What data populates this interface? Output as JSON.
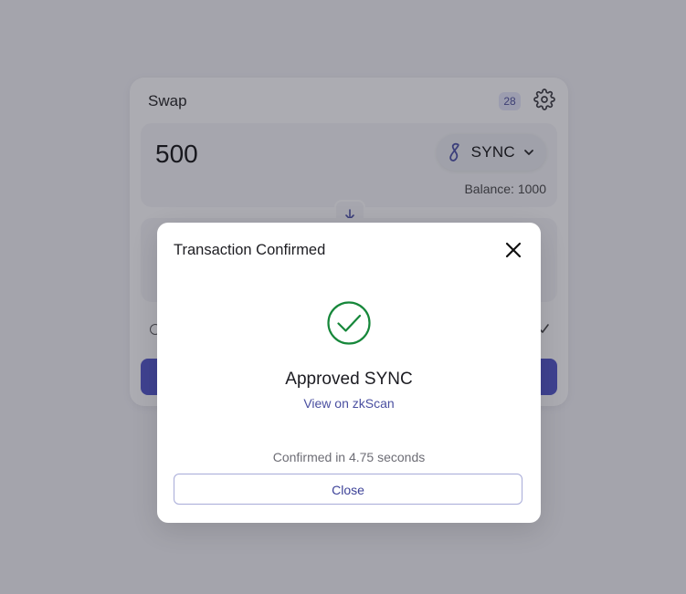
{
  "swap": {
    "title": "Swap",
    "slippage_badge": "28",
    "from": {
      "amount": "500",
      "token_symbol": "SYNC",
      "balance": "Balance: 1000"
    }
  },
  "modal": {
    "title": "Transaction Confirmed",
    "status": "Approved SYNC",
    "explorer_link": "View on zkScan",
    "confirmed_time": "Confirmed in 4.75 seconds",
    "close_label": "Close"
  },
  "colors": {
    "accent": "#4f55c8",
    "success": "#16873a",
    "link": "#4a4fa0",
    "overlay": "rgba(38,38,52,0.38)"
  },
  "icons": {
    "settings": "gear-icon",
    "token": "sync-token-icon",
    "dropdown": "chevron-down-icon",
    "switch": "arrow-down-icon",
    "success": "check-circle-icon",
    "close": "close-icon"
  }
}
